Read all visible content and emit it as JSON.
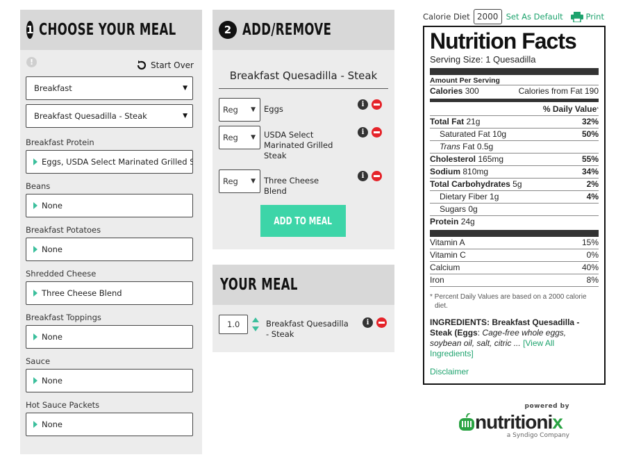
{
  "step1": {
    "number": "1",
    "title": "CHOOSE YOUR MEAL",
    "start_over": "Start Over",
    "meal_type": "Breakfast",
    "meal_item": "Breakfast Quesadilla - Steak",
    "sections": [
      {
        "label": "Breakfast Protein",
        "value": "Eggs, USDA Select Marinated Grilled Steak"
      },
      {
        "label": "Beans",
        "value": "None"
      },
      {
        "label": "Breakfast Potatoes",
        "value": "None"
      },
      {
        "label": "Shredded Cheese",
        "value": "Three Cheese Blend"
      },
      {
        "label": "Breakfast Toppings",
        "value": "None"
      },
      {
        "label": "Sauce",
        "value": "None"
      },
      {
        "label": "Hot Sauce Packets",
        "value": "None"
      }
    ]
  },
  "step2": {
    "number": "2",
    "title": "ADD/REMOVE",
    "item_title": "Breakfast Quesadilla - Steak",
    "ingredients": [
      {
        "portion": "Reg",
        "name": "Eggs"
      },
      {
        "portion": "Reg",
        "name": "USDA Select Marinated Grilled Steak"
      },
      {
        "portion": "Reg",
        "name": "Three Cheese Blend"
      }
    ],
    "add_button": "ADD TO MEAL"
  },
  "your_meal": {
    "title": "YOUR MEAL",
    "qty": "1.0",
    "item": "Breakfast Quesadilla - Steak"
  },
  "topbar": {
    "calorie_label": "Calorie Diet",
    "calorie_value": "2000",
    "set_default": "Set As Default",
    "print": "Print"
  },
  "nutrition": {
    "title": "Nutrition Facts",
    "serving": "Serving Size: 1 Quesadilla",
    "amount_per": "Amount Per Serving",
    "calories_label": "Calories",
    "calories": "300",
    "cal_from_fat_label": "Calories from Fat",
    "cal_from_fat": "190",
    "dv_header": "% Daily Value",
    "dv_star": "*",
    "total_fat_label": "Total Fat",
    "total_fat": "21g",
    "total_fat_pct": "32%",
    "sat_fat_label": "Saturated Fat",
    "sat_fat": "10g",
    "sat_fat_pct": "50%",
    "trans_label": "Trans",
    "trans_rest": "Fat",
    "trans": "0.5g",
    "chol_label": "Cholesterol",
    "chol": "165mg",
    "chol_pct": "55%",
    "sodium_label": "Sodium",
    "sodium": "810mg",
    "sodium_pct": "34%",
    "carb_label": "Total Carbohydrates",
    "carb": "5g",
    "carb_pct": "2%",
    "fiber_label": "Dietary Fiber",
    "fiber": "1g",
    "fiber_pct": "4%",
    "sugars_label": "Sugars",
    "sugars": "0g",
    "protein_label": "Protein",
    "protein": "24g",
    "vitamins": [
      {
        "name": "Vitamin A",
        "pct": "15%"
      },
      {
        "name": "Vitamin C",
        "pct": "0%"
      },
      {
        "name": "Calcium",
        "pct": "40%"
      },
      {
        "name": "Iron",
        "pct": "8%"
      }
    ],
    "footnote": "* Percent Daily Values are based on a 2000 calorie diet.",
    "ingredients_label": "INGREDIENTS:",
    "ingredients_item": "Breakfast Quesadilla - Steak",
    "ingredients_open": "(",
    "ingredients_first": "Eggs",
    "ingredients_colon": ":",
    "ingredients_text": "Cage-free whole eggs, soybean oil, salt, citric ...",
    "view_all": "[View All Ingredients]",
    "disclaimer": "Disclaimer"
  },
  "powered": {
    "by": "powered by",
    "brand_a": "nutritioni",
    "brand_b": "x",
    "sub": "a Syndigo Company"
  },
  "colors": {
    "accent": "#3dd5a8",
    "link": "#1ea36e",
    "remove": "#e5242a"
  }
}
